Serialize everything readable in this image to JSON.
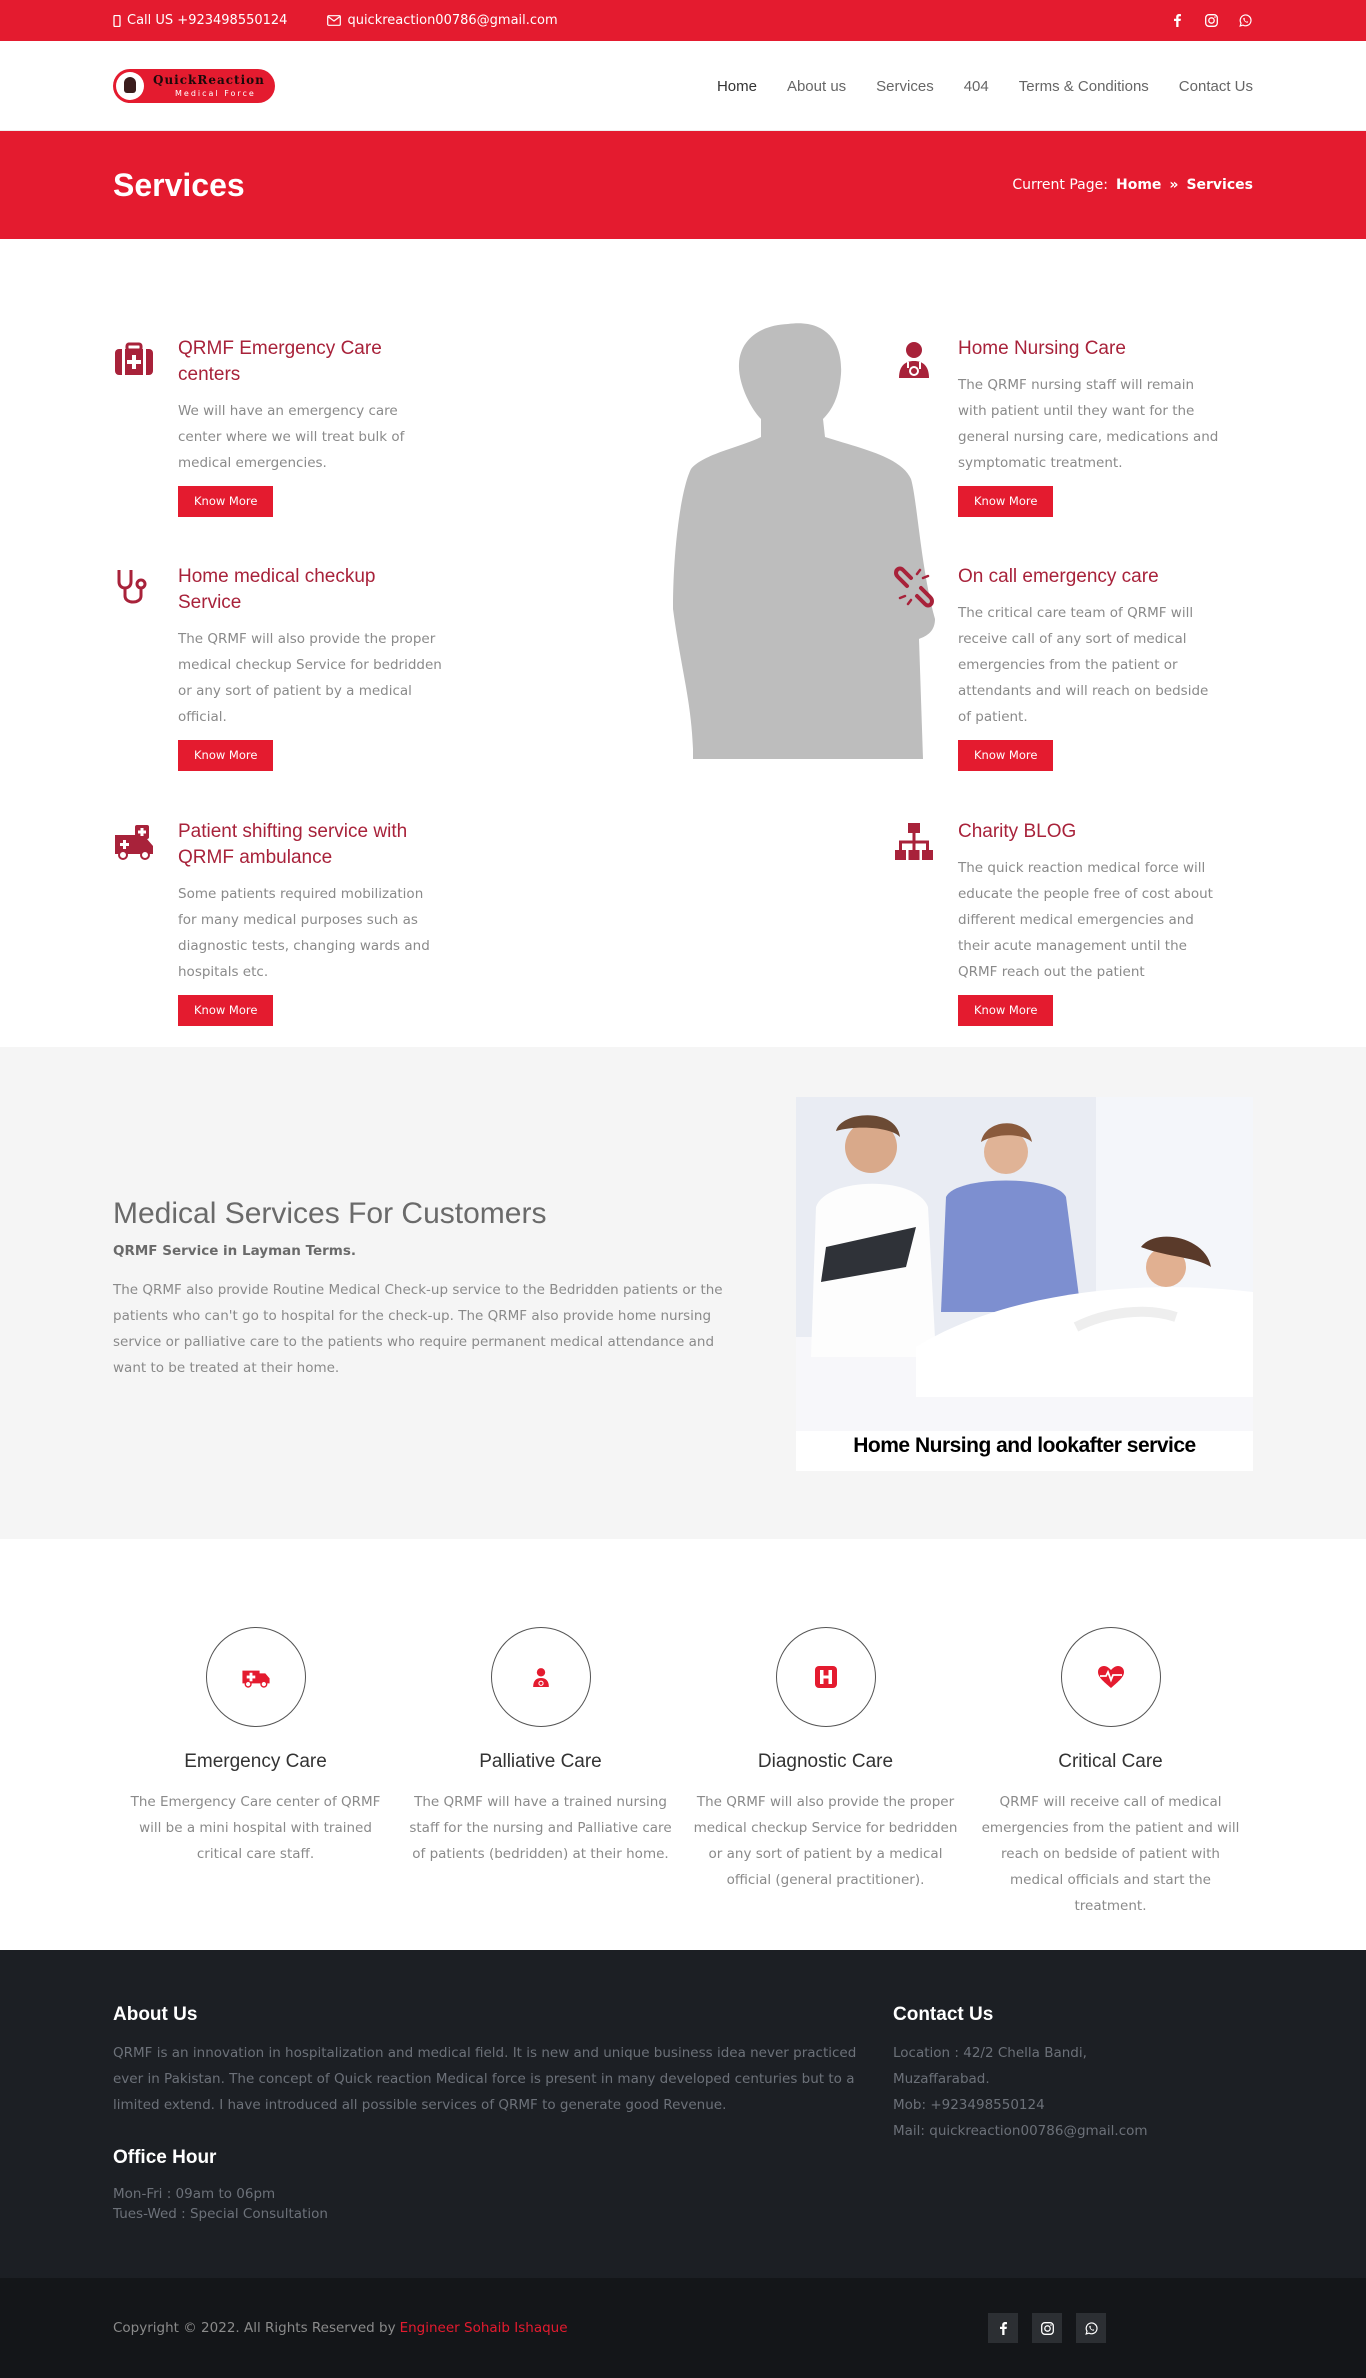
{
  "topbar": {
    "phone": "Call US +923498550124",
    "email": "quickreaction00786@gmail.com"
  },
  "logo": {
    "name": "QuickReaction",
    "tagline": "Medical Force"
  },
  "nav": {
    "items": [
      {
        "label": "Home"
      },
      {
        "label": "About us"
      },
      {
        "label": "Services"
      },
      {
        "label": "404"
      },
      {
        "label": "Terms & Conditions"
      },
      {
        "label": "Contact Us"
      }
    ]
  },
  "header": {
    "title": "Services",
    "breadcrumb_prefix": "Current Page:",
    "crumb_home": "Home",
    "crumb_sep": "»",
    "crumb_current": "Services"
  },
  "services": [
    {
      "title": "QRMF Emergency Care centers",
      "text": "We will have an emergency care center where we will treat bulk of medical emergencies.",
      "button": "Know More",
      "icon": "first-aid-kit-icon"
    },
    {
      "title": "Home Nursing Care",
      "text": "The QRMF nursing staff will remain with patient until they want for the general nursing care, medications and symptomatic treatment.",
      "button": "Know More",
      "icon": "doctor-icon"
    },
    {
      "title": "Home medical checkup Service",
      "text": "The QRMF will also provide the proper medical checkup Service for bedridden or any sort of patient by a medical official.",
      "button": "Know More",
      "icon": "stethoscope-icon"
    },
    {
      "title": "On call emergency care",
      "text": "The critical care team of QRMF will receive call of any sort of medical emergencies from the patient or attendants and will reach on bedside of patient.",
      "button": "Know More",
      "icon": "chain-link-icon"
    },
    {
      "title": "Patient shifting service with QRMF ambulance",
      "text": "Some patients required mobilization for many medical purposes such as diagnostic tests, changing wards and hospitals etc.",
      "button": "Know More",
      "icon": "ambulance-icon"
    },
    {
      "title": "Charity BLOG",
      "text": "The quick reaction medical force will educate the people free of cost about different medical emergencies and their acute management until the QRMF reach out the patient",
      "button": "Know More",
      "icon": "sitemap-icon"
    }
  ],
  "medical": {
    "title": "Medical Services For Customers",
    "subtitle": "QRMF Service in Layman Terms.",
    "text": "The QRMF also provide Routine Medical Check-up service to the Bedridden patients or the patients who can't go to hospital for the check-up. The QRMF also provide home nursing service or palliative care to the patients who require permanent medical attendance and want to be treated at their home.",
    "image_caption": "Home Nursing and lookafter service"
  },
  "features": [
    {
      "title": "Emergency Care",
      "text": "The Emergency Care center of QRMF will be a mini hospital with trained critical care staff.",
      "icon": "ambulance-icon"
    },
    {
      "title": "Palliative Care",
      "text": "The QRMF will have a trained nursing staff for the nursing and Palliative care of patients (bedridden) at their home.",
      "icon": "doctor-icon"
    },
    {
      "title": "Diagnostic Care",
      "text": "The QRMF will also provide the proper medical checkup Service for bedridden or any sort of patient by a medical official (general practitioner).",
      "icon": "hospital-icon"
    },
    {
      "title": "Critical Care",
      "text": "QRMF will receive call of medical emergencies from the patient and will reach on bedside of patient with medical officials and start the treatment.",
      "icon": "heartbeat-icon"
    }
  ],
  "footer": {
    "about_title": "About Us",
    "about_text": "QRMF is an innovation in hospitalization and medical field. It is new and unique business idea never practiced ever in Pakistan. The concept of Quick reaction Medical force is present in many developed centuries but to a limited extend. I have introduced all possible services of QRMF to generate good Revenue.",
    "hours_title": "Office Hour",
    "hours_1": "Mon-Fri : 09am to 06pm",
    "hours_2": "Tues-Wed : Special Consultation",
    "contact_title": "Contact Us",
    "location": "Location : 42/2 Chella Bandi, Muzaffarabad.",
    "mob": "Mob: +923498550124",
    "mail": "Mail: quickreaction00786@gmail.com"
  },
  "copyright": {
    "text": "Copyright © 2022. All Rights Reserved by",
    "author": "Engineer Sohaib Ishaque"
  },
  "colors": {
    "brand": "#e41b2f",
    "heading": "#a8223a",
    "footer": "#1c1f24"
  }
}
